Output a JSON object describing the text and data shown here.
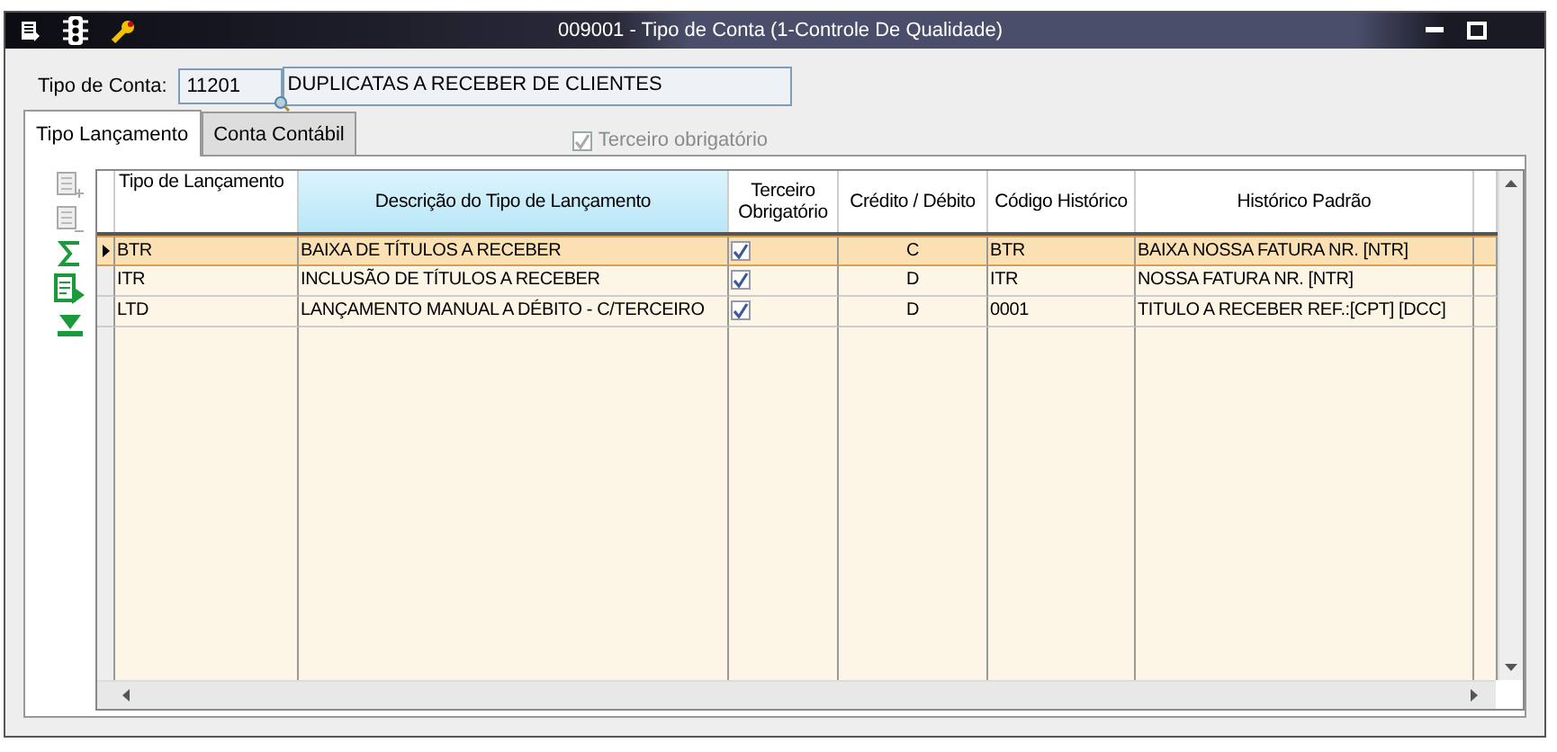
{
  "window": {
    "title": "009001 - Tipo de Conta (1-Controle De Qualidade)"
  },
  "account": {
    "label": "Tipo de Conta:",
    "code": "11201",
    "description": "DUPLICATAS A RECEBER DE CLIENTES"
  },
  "tabs": [
    {
      "label": "Tipo Lançamento",
      "selected": true
    },
    {
      "label": "Conta Contábil",
      "selected": false
    }
  ],
  "third_party_required": {
    "label": "Terceiro obrigatório",
    "checked": true,
    "disabled": true
  },
  "table": {
    "columns": [
      "Tipo de Lançamento",
      "Descrição do Tipo de Lançamento",
      "Terceiro Obrigatório",
      "Crédito / Débito",
      "Código Histórico",
      "Histórico Padrão"
    ],
    "rows": [
      {
        "type": "BTR",
        "description": "BAIXA DE TÍTULOS A RECEBER",
        "third_party": true,
        "credit_debit": "C",
        "history_code": "BTR",
        "standard_history": "BAIXA NOSSA FATURA NR. [NTR]",
        "selected": true
      },
      {
        "type": "ITR",
        "description": "INCLUSÃO DE TÍTULOS A RECEBER",
        "third_party": true,
        "credit_debit": "D",
        "history_code": "ITR",
        "standard_history": "NOSSA FATURA NR. [NTR]",
        "selected": false
      },
      {
        "type": "LTD",
        "description": "LANÇAMENTO MANUAL A DÉBITO - C/TERCEIRO",
        "third_party": true,
        "credit_debit": "D",
        "history_code": "0001",
        "standard_history": "TITULO A RECEBER REF.:[CPT] [DCC]",
        "selected": false
      }
    ]
  }
}
